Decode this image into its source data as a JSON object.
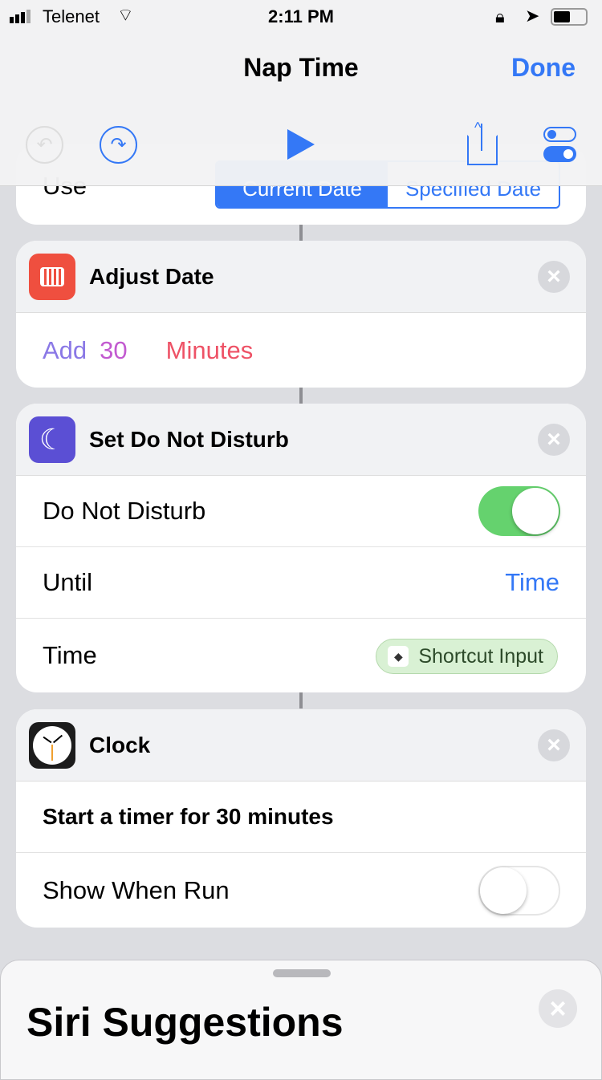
{
  "status": {
    "carrier": "Telenet",
    "time": "2:11 PM"
  },
  "nav": {
    "title": "Nap Time",
    "done": "Done"
  },
  "card_top": {
    "label": "Use",
    "segments": [
      "Current Date",
      "Specified Date"
    ]
  },
  "adjust": {
    "title": "Adjust Date",
    "op": "Add",
    "amount": "30",
    "unit": "Minutes"
  },
  "dnd": {
    "title": "Set Do Not Disturb",
    "row1": "Do Not Disturb",
    "row1_on": true,
    "row2": "Until",
    "row2_value": "Time",
    "row3": "Time",
    "row3_value": "Shortcut Input"
  },
  "clock": {
    "title": "Clock",
    "row1": "Start a timer for 30 minutes",
    "row2": "Show When Run",
    "row2_on": false
  },
  "sheet": {
    "title": "Siri Suggestions"
  },
  "colors": {
    "accent": "#3478f6",
    "toggle_on": "#65d26e"
  }
}
